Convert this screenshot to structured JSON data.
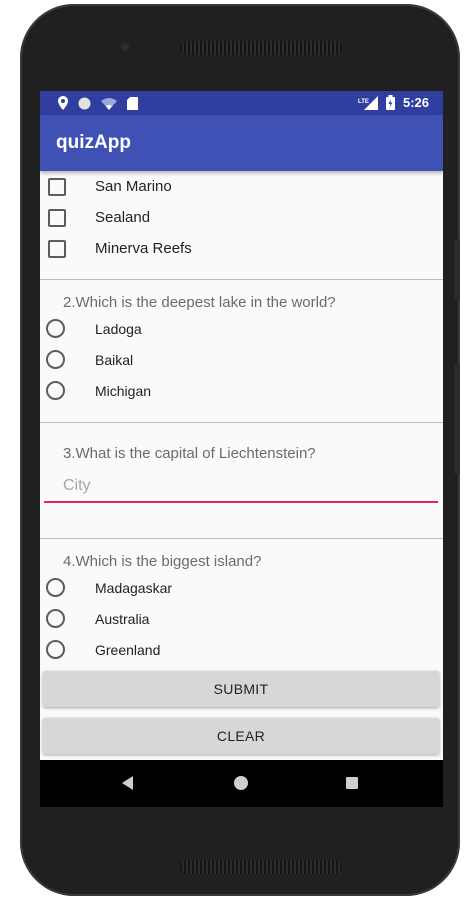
{
  "status_bar": {
    "time": "5:26",
    "network": "LTE",
    "icons": [
      "location-icon",
      "circle-icon",
      "wifi-icon",
      "sd-card-icon",
      "signal-icon",
      "battery-icon"
    ]
  },
  "app": {
    "title": "quizApp",
    "colors": {
      "primary": "#3f51b5",
      "primary_dark": "#303f9f",
      "accent": "#e91e63"
    }
  },
  "question1": {
    "options": [
      {
        "label": "San Marino",
        "checked": false
      },
      {
        "label": "Sealand",
        "checked": false
      },
      {
        "label": "Minerva Reefs",
        "checked": false
      }
    ]
  },
  "question2": {
    "text": "2.Which is the deepest lake in the world?",
    "options": [
      {
        "label": "Ladoga",
        "selected": false
      },
      {
        "label": "Baikal",
        "selected": false
      },
      {
        "label": "Michigan",
        "selected": false
      }
    ]
  },
  "question3": {
    "text": "3.What is the capital of Liechtenstein?",
    "input": {
      "value": "",
      "placeholder": "City"
    }
  },
  "question4": {
    "text": "4.Which is the biggest island?",
    "options": [
      {
        "label": "Madagaskar",
        "selected": false
      },
      {
        "label": "Australia",
        "selected": false
      },
      {
        "label": "Greenland",
        "selected": false
      }
    ]
  },
  "buttons": {
    "submit": "SUBMIT",
    "clear": "CLEAR"
  },
  "nav_bar": {
    "icons": [
      "back-icon",
      "home-icon",
      "recents-icon"
    ]
  }
}
